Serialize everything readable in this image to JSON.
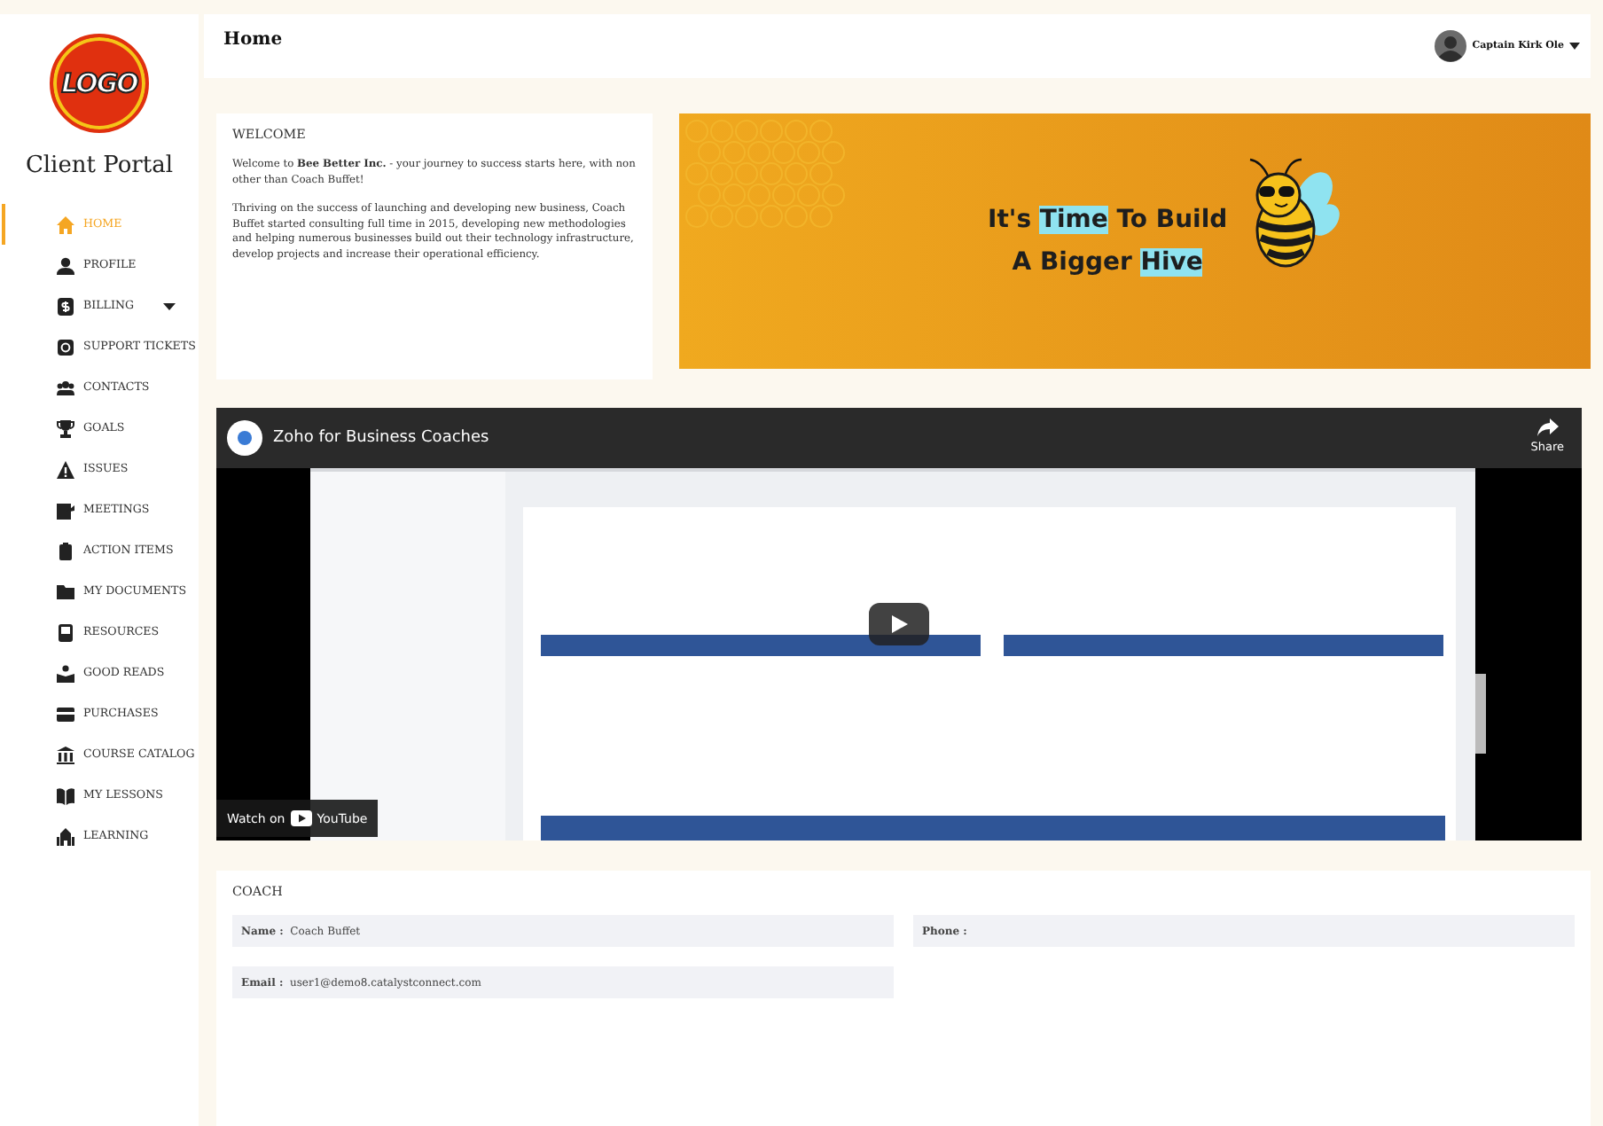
{
  "sidebar": {
    "logo": "LOGO",
    "title": "Client Portal",
    "items": [
      {
        "label": "HOME",
        "selected": true,
        "kind": "link"
      },
      {
        "label": "PROFILE",
        "selected": false,
        "kind": "link"
      },
      {
        "label": "BILLING",
        "selected": false,
        "kind": "dropdown"
      },
      {
        "label": "SUPPORT TICKETS",
        "selected": false,
        "kind": "link"
      },
      {
        "label": "CONTACTS",
        "selected": false,
        "kind": "link"
      },
      {
        "label": "GOALS",
        "selected": false,
        "kind": "link"
      },
      {
        "label": "ISSUES",
        "selected": false,
        "kind": "link"
      },
      {
        "label": "MEETINGS",
        "selected": false,
        "kind": "link"
      },
      {
        "label": "ACTION ITEMS",
        "selected": false,
        "kind": "link"
      },
      {
        "label": "MY DOCUMENTS",
        "selected": false,
        "kind": "link"
      },
      {
        "label": "RESOURCES",
        "selected": false,
        "kind": "link"
      },
      {
        "label": "GOOD READS",
        "selected": false,
        "kind": "link"
      },
      {
        "label": "PURCHASES",
        "selected": false,
        "kind": "link"
      },
      {
        "label": "COURSE CATALOG",
        "selected": false,
        "kind": "link"
      },
      {
        "label": "MY LESSONS",
        "selected": false,
        "kind": "link"
      },
      {
        "label": "LEARNING",
        "selected": false,
        "kind": "link"
      }
    ]
  },
  "header": {
    "title": "Home",
    "user": "Captain Kirk Ole"
  },
  "welcome": {
    "heading": "WELCOME",
    "paragraphs": [
      "Welcome to **Bee Better Inc.** - your journey to success starts here, with non other than Coach Buffet!",
      "Thriving on the success of launching and developing new business, Coach Buffet started consulting full time in 2015, developing new methodologies and helping numerous businesses build out their technology infrastructure, develop projects and increase their operational efficiency."
    ]
  },
  "banner": {
    "lines": [
      [
        {
          "text": "It's ",
          "highlight": false
        },
        {
          "text": "Time",
          "highlight": true
        },
        {
          "text": " To Build",
          "highlight": false
        }
      ],
      [
        {
          "text": "A Bigger ",
          "highlight": false
        },
        {
          "text": "Hive",
          "highlight": true
        }
      ]
    ]
  },
  "video": {
    "kind": "picture",
    "channel_title": "Zoho for Business Coaches",
    "share_label": "Share",
    "watch_label": "Watch on",
    "brand": "YouTube"
  },
  "coach": {
    "heading": "COACH",
    "fields": [
      {
        "label": "Name :",
        "value": "Coach Buffet"
      },
      {
        "label": "Phone :"
      },
      {
        "label": "Email :",
        "value": "user1@demo8.catalystconnect.com"
      }
    ]
  }
}
